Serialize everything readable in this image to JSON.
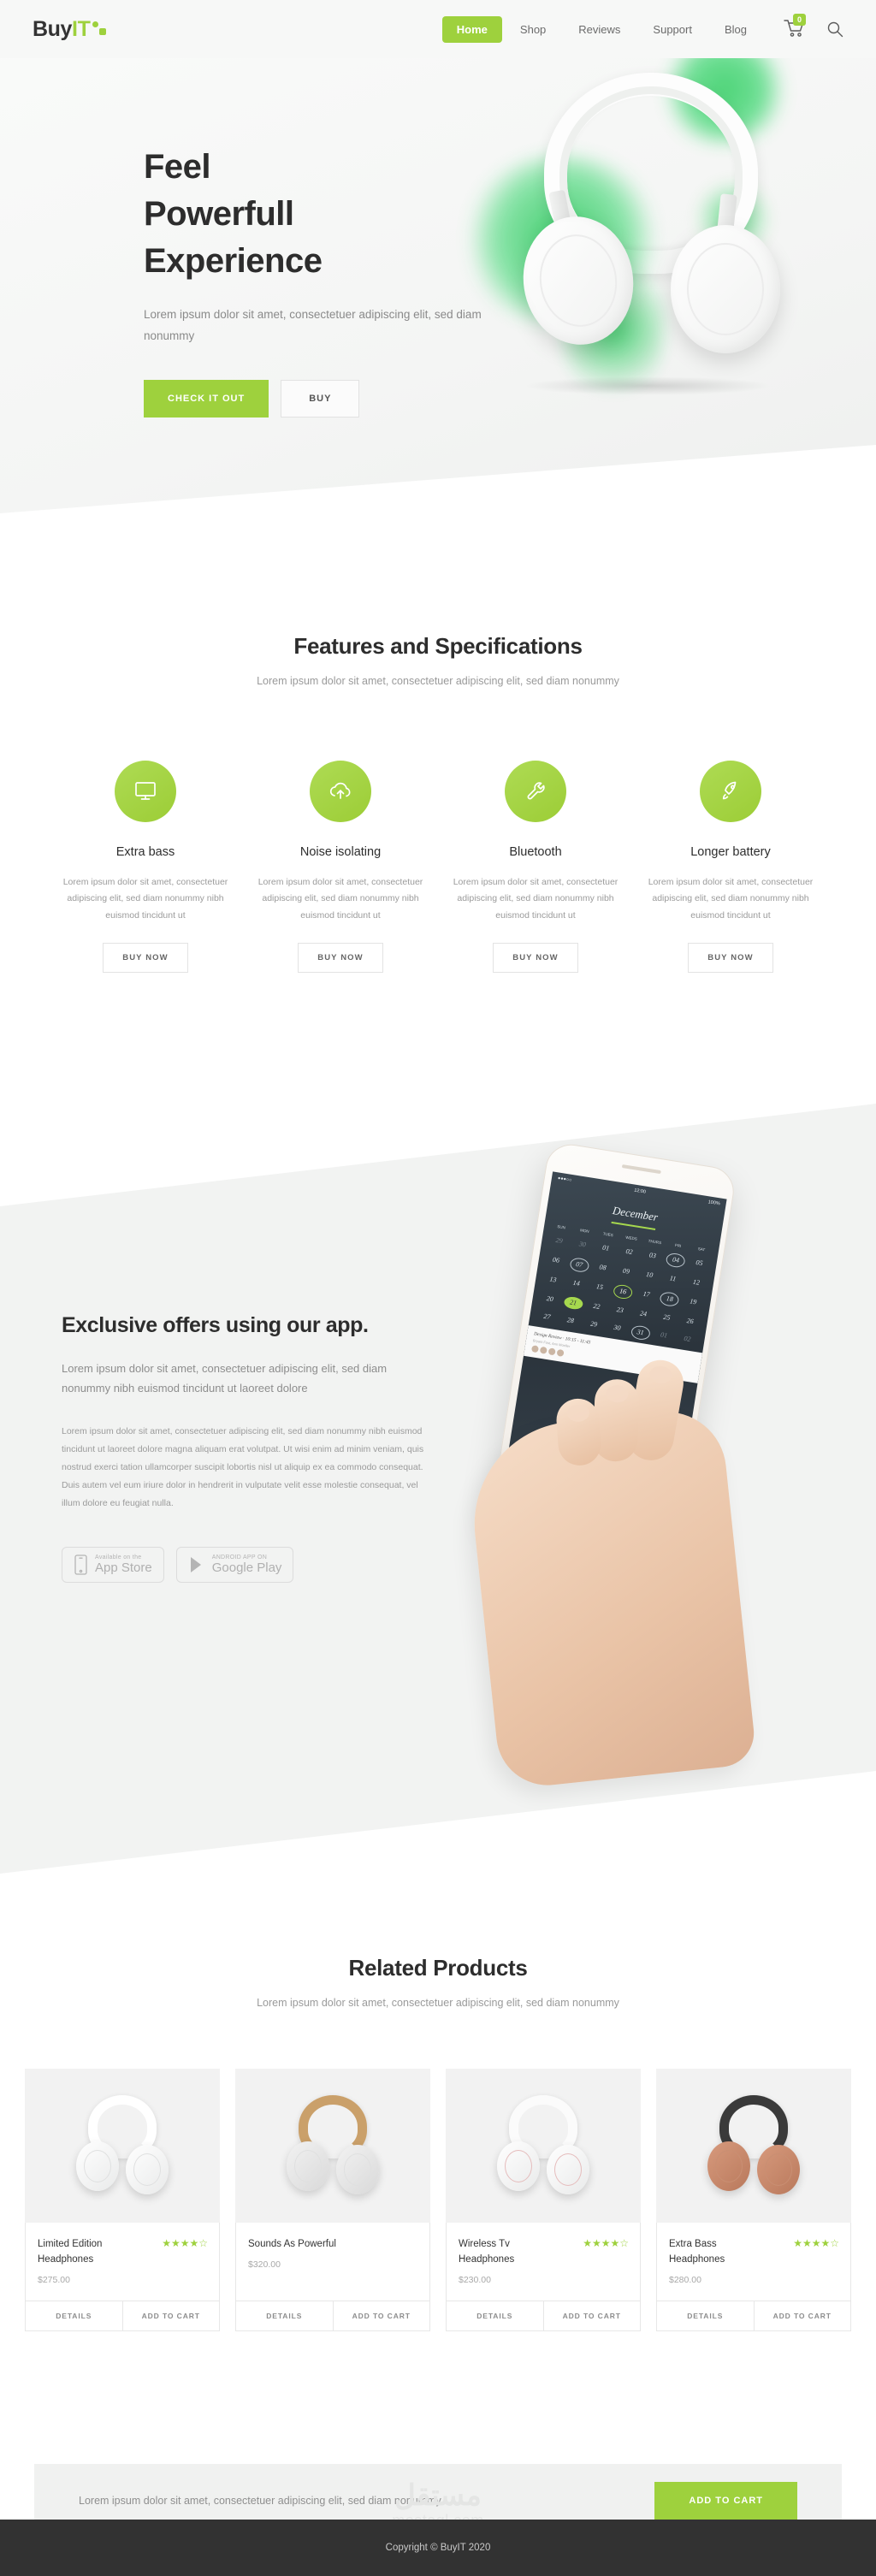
{
  "header": {
    "logo_buy": "Buy",
    "logo_it": "IT",
    "nav": [
      {
        "label": "Home",
        "active": true
      },
      {
        "label": "Shop",
        "active": false
      },
      {
        "label": "Reviews",
        "active": false
      },
      {
        "label": "Support",
        "active": false
      },
      {
        "label": "Blog",
        "active": false
      }
    ],
    "cart_count": "0",
    "cart_icon": "shopping-cart-icon",
    "search_icon": "search-icon"
  },
  "hero": {
    "title_line1": "Feel",
    "title_line2": "Powerfull",
    "title_line3": "Experience",
    "paragraph": "Lorem ipsum dolor sit amet, consectetuer adipiscing elit, sed diam nonummy",
    "primary_button": "CHECK IT OUT",
    "secondary_button": "BUY"
  },
  "features": {
    "title": "Features and Specifications",
    "subtitle": "Lorem ipsum dolor sit amet, consectetuer adipiscing elit, sed diam nonummy",
    "items": [
      {
        "icon": "monitor-icon",
        "title": "Extra bass",
        "text": "Lorem ipsum dolor sit amet, consectetuer adipiscing elit, sed diam nonummy nibh euismod tincidunt ut",
        "button": "BUY NOW"
      },
      {
        "icon": "cloud-upload-icon",
        "title": "Noise isolating",
        "text": "Lorem ipsum dolor sit amet, consectetuer adipiscing elit, sed diam nonummy nibh euismod tincidunt ut",
        "button": "BUY NOW"
      },
      {
        "icon": "wrench-icon",
        "title": "Bluetooth",
        "text": "Lorem ipsum dolor sit amet, consectetuer adipiscing elit, sed diam nonummy nibh euismod tincidunt ut",
        "button": "BUY NOW"
      },
      {
        "icon": "rocket-icon",
        "title": "Longer battery",
        "text": "Lorem ipsum dolor sit amet, consectetuer adipiscing elit, sed diam nonummy nibh euismod tincidunt ut",
        "button": "BUY NOW"
      }
    ]
  },
  "app_section": {
    "title": "Exclusive offers using our app.",
    "lead": "Lorem ipsum dolor sit amet, consectetuer adipiscing elit, sed diam nonummy nibh euismod tincidunt ut laoreet dolore",
    "body": "Lorem ipsum dolor sit amet, consectetuer adipiscing elit, sed diam nonummy nibh euismod tincidunt ut laoreet dolore magna aliquam erat volutpat. Ut wisi enim ad minim veniam, quis nostrud exerci tation ullamcorper suscipit lobortis nisl ut aliquip ex ea commodo consequat. Duis autem vel eum iriure dolor in hendrerit in vulputate velit esse molestie consequat, vel illum dolore eu feugiat nulla.",
    "app_store_small": "Available on the",
    "app_store_big": "App Store",
    "google_play_small": "ANDROID APP ON",
    "google_play_big": "Google Play",
    "phone_preview": {
      "status_left": "●●●○○",
      "status_time": "12:00",
      "status_battery": "100%",
      "calendar_title": "December",
      "day_names": [
        "SUN",
        "MON",
        "TUES",
        "WEDS",
        "THURS",
        "FRI",
        "SAT"
      ],
      "weeks": [
        [
          "29",
          "30",
          "01",
          "02",
          "03",
          "04",
          "05"
        ],
        [
          "06",
          "07",
          "08",
          "09",
          "10",
          "11",
          "12"
        ],
        [
          "13",
          "14",
          "15",
          "16",
          "17",
          "18",
          "19"
        ],
        [
          "20",
          "21",
          "22",
          "23",
          "24",
          "25",
          "26"
        ],
        [
          "27",
          "28",
          "29",
          "30",
          "31",
          "01",
          "02"
        ]
      ],
      "event_title": "Design Review · 10:15 - 11:45",
      "event_sub": "Bryant Fost, Ann Moeller"
    }
  },
  "related": {
    "title": "Related Products",
    "subtitle": "Lorem ipsum dolor sit amet, consectetuer adipiscing elit, sed diam nonummy",
    "details_label": "DETAILS",
    "cart_label": "ADD TO CART",
    "products": [
      {
        "name": "Limited Edition Headphones",
        "price": "$275.00",
        "rating": 4,
        "rating_max": 5,
        "style": "white"
      },
      {
        "name": "Sounds As Powerful",
        "price": "$320.00",
        "rating": 0,
        "rating_max": 5,
        "style": "tan"
      },
      {
        "name": "Wireless Tv Headphones",
        "price": "$230.00",
        "rating": 4,
        "rating_max": 5,
        "style": "wtv"
      },
      {
        "name": "Extra Bass Headphones",
        "price": "$280.00",
        "rating": 4,
        "rating_max": 5,
        "style": "rose"
      }
    ]
  },
  "cta": {
    "text": "Lorem ipsum dolor sit amet, consectetuer adipiscing elit, sed diam nonummy",
    "button": "ADD TO CART"
  },
  "watermark": {
    "arabic": "مستقل",
    "latin": "mostaql.com"
  },
  "footer": {
    "copyright": "Copyright © BuyIT 2020"
  },
  "colors": {
    "accent_green": "#9ed13d",
    "hero_bg": "#f4f5f4",
    "footer_bg": "#323232",
    "text_dark": "#2d2d2d",
    "text_muted": "#9a9a9a"
  }
}
